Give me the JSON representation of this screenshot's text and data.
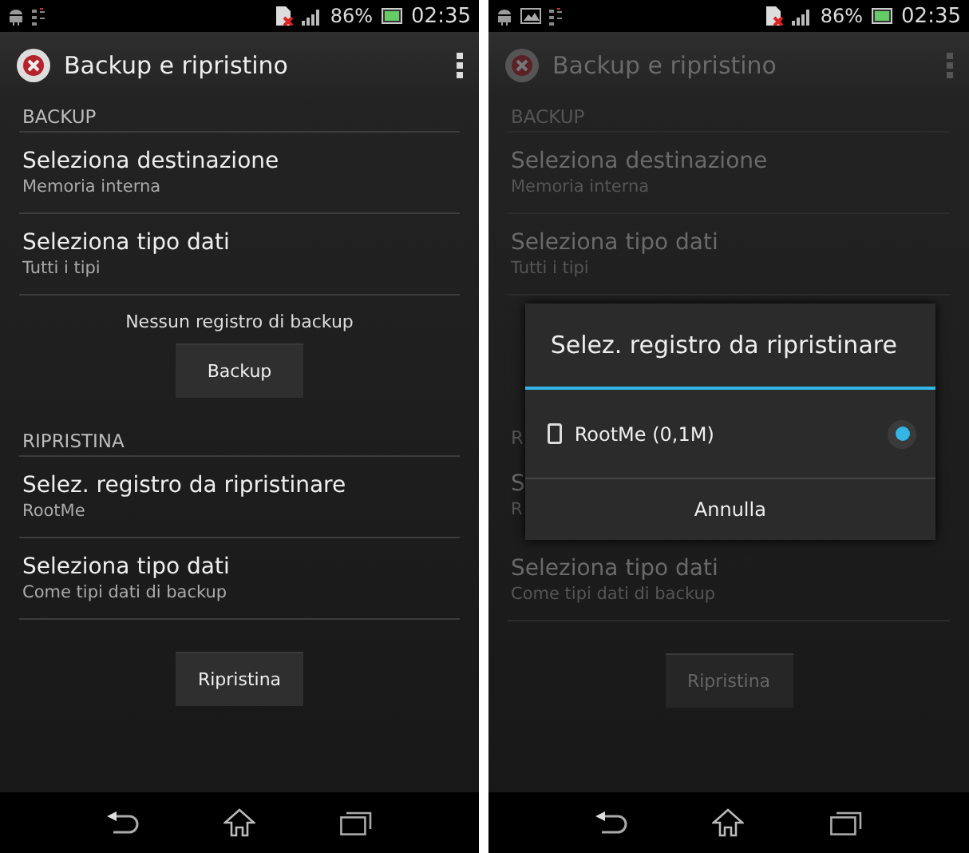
{
  "screens": [
    {
      "dimmed": false,
      "status_bar": {
        "notification_icons": [
          {
            "kind": "android"
          },
          {
            "kind": "sd-card"
          }
        ],
        "battery": "86%",
        "time": "02:35"
      },
      "app_bar": {
        "title": "Backup e ripristino"
      },
      "blocks": [
        {
          "kind": "header",
          "text": "BACKUP"
        },
        {
          "kind": "item",
          "title": "Seleziona destinazione",
          "subtitle": "Memoria interna"
        },
        {
          "kind": "item",
          "title": "Seleziona tipo dati",
          "subtitle": "Tutti i tipi"
        },
        {
          "kind": "action",
          "message": "Nessun registro di backup",
          "button": "Backup"
        },
        {
          "kind": "header",
          "text": "RIPRISTINA"
        },
        {
          "kind": "item",
          "title": "Selez. registro da ripristinare",
          "subtitle": "RootMe"
        },
        {
          "kind": "item",
          "title": "Seleziona tipo dati",
          "subtitle": "Come tipi dati di backup"
        },
        {
          "kind": "action",
          "button": "Ripristina"
        }
      ]
    },
    {
      "dimmed": true,
      "status_bar": {
        "notification_icons": [
          {
            "kind": "android"
          },
          {
            "kind": "picture"
          },
          {
            "kind": "sd-card"
          }
        ],
        "battery": "86%",
        "time": "02:35"
      },
      "app_bar": {
        "title": "Backup e ripristino"
      },
      "blocks": [
        {
          "kind": "header",
          "text": "BACKUP"
        },
        {
          "kind": "item",
          "title": "Seleziona destinazione",
          "subtitle": "Memoria interna"
        },
        {
          "kind": "item",
          "title": "Seleziona tipo dati",
          "subtitle": "Tutti i tipi"
        },
        {
          "kind": "dialog",
          "behind": {
            "header": "R",
            "title": "S",
            "subtitle": "R"
          },
          "title": "Selez. registro da ripristinare",
          "options": [
            {
              "label": "RootMe (0,1M)",
              "selected": true
            }
          ],
          "button": "Annulla"
        },
        {
          "kind": "item",
          "title": "Seleziona tipo dati",
          "subtitle": "Come tipi dati di backup"
        },
        {
          "kind": "action",
          "button": "Ripristina"
        }
      ]
    }
  ]
}
